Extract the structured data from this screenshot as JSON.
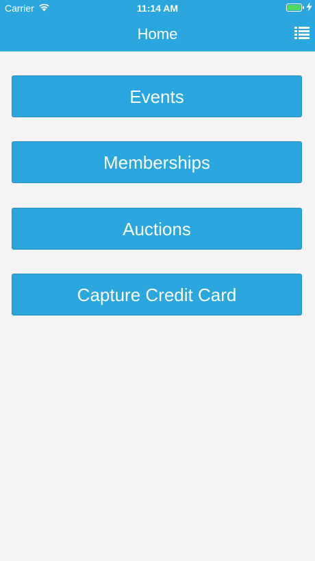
{
  "status_bar": {
    "carrier": "Carrier",
    "time": "11:14 AM",
    "wifi_icon": "wifi-icon",
    "battery_icon": "battery-icon",
    "battery_level": 1.0,
    "charging_icon": "lightning-bolt-icon"
  },
  "nav": {
    "title": "Home",
    "menu_icon": "list-menu-icon"
  },
  "menu": {
    "events_label": "Events",
    "memberships_label": "Memberships",
    "auctions_label": "Auctions",
    "capture_label": "Capture Credit Card"
  },
  "colors": {
    "accent": "#2aa7df",
    "background": "#f4f4f4",
    "text_on_accent": "#ffffff",
    "battery_fill": "#4cd964"
  }
}
